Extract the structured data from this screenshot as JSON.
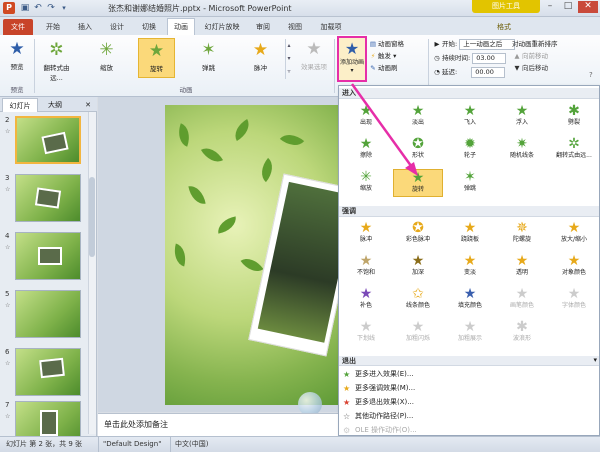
{
  "window": {
    "title": "张杰和谢娜结婚照片.pptx - Microsoft PowerPoint",
    "context_tab_title": "图片工具",
    "minimize": "–",
    "maximize": "□",
    "close": "✕"
  },
  "tabs": [
    {
      "label": "文件"
    },
    {
      "label": "开始"
    },
    {
      "label": "插入"
    },
    {
      "label": "设计"
    },
    {
      "label": "切换"
    },
    {
      "label": "动画"
    },
    {
      "label": "幻灯片放映"
    },
    {
      "label": "审阅"
    },
    {
      "label": "视图"
    },
    {
      "label": "加载项"
    },
    {
      "label": "格式"
    }
  ],
  "ribbon": {
    "preview": {
      "label": "预览",
      "group": "预览"
    },
    "animation_gallery": [
      {
        "label": "翻转式由远..."
      },
      {
        "label": "缩放"
      },
      {
        "label": "旋转"
      },
      {
        "label": "弹跳"
      },
      {
        "label": "脉冲"
      }
    ],
    "effect_options": "效果选项",
    "group_animation": "动画",
    "add_animation": "添加动画",
    "anim_pane": "动画窗格",
    "trigger": "触发",
    "anim_painter": "动画刷",
    "start_label": "开始:",
    "start_value": "上一动画之后",
    "duration_label": "持续时间:",
    "duration_value": "03.00",
    "delay_label": "延迟:",
    "delay_value": "00.00",
    "reorder_title": "对动画重新排序",
    "move_earlier": "向前移动",
    "move_later": "向后移动"
  },
  "left_pane": {
    "tab_slides": "幻灯片",
    "tab_outline": "大纲",
    "close": "✕",
    "slides": [
      {
        "num": "2"
      },
      {
        "num": "3"
      },
      {
        "num": "4"
      },
      {
        "num": "5"
      },
      {
        "num": "6"
      },
      {
        "num": "7"
      }
    ],
    "star": "☆"
  },
  "notes_placeholder": "单击此处添加备注",
  "status": {
    "slide_info": "幻灯片 第 2 张，共 9 张",
    "theme": "\"Default Design\"",
    "language": "中文(中国)"
  },
  "dropdown": {
    "section_entrance": "进入",
    "entrance": [
      {
        "label": "出现"
      },
      {
        "label": "淡出"
      },
      {
        "label": "飞入"
      },
      {
        "label": "浮入"
      },
      {
        "label": "劈裂"
      },
      {
        "label": "擦除"
      },
      {
        "label": "形状"
      },
      {
        "label": "轮子"
      },
      {
        "label": "随机线条"
      },
      {
        "label": "翻转式由远..."
      },
      {
        "label": "缩放"
      },
      {
        "label": "旋转"
      },
      {
        "label": "弹跳"
      }
    ],
    "section_emphasis": "强调",
    "emphasis": [
      {
        "label": "脉冲"
      },
      {
        "label": "彩色脉冲"
      },
      {
        "label": "跷跷板"
      },
      {
        "label": "陀螺旋"
      },
      {
        "label": "放大/缩小"
      },
      {
        "label": "不饱和"
      },
      {
        "label": "加深"
      },
      {
        "label": "变淡"
      },
      {
        "label": "透明"
      },
      {
        "label": "对象颜色"
      },
      {
        "label": "补色"
      },
      {
        "label": "线条颜色"
      },
      {
        "label": "填充颜色"
      },
      {
        "label": "画笔颜色"
      },
      {
        "label": "字体颜色"
      },
      {
        "label": "下划线"
      },
      {
        "label": "加粗闪烁"
      },
      {
        "label": "加粗展示"
      },
      {
        "label": "波浪形"
      }
    ],
    "section_exit": "退出",
    "links": [
      {
        "label": "更多进入效果(E)..."
      },
      {
        "label": "更多强调效果(M)..."
      },
      {
        "label": "更多退出效果(X)..."
      },
      {
        "label": "其他动作路径(P)..."
      },
      {
        "label": "OLE 操作动作(O)..."
      }
    ]
  },
  "colors": {
    "highlight_border": "#e62ea8",
    "selected_fill": "#fbd97a",
    "file_tab": "#c8442a",
    "context_tab": "#e2c400"
  }
}
